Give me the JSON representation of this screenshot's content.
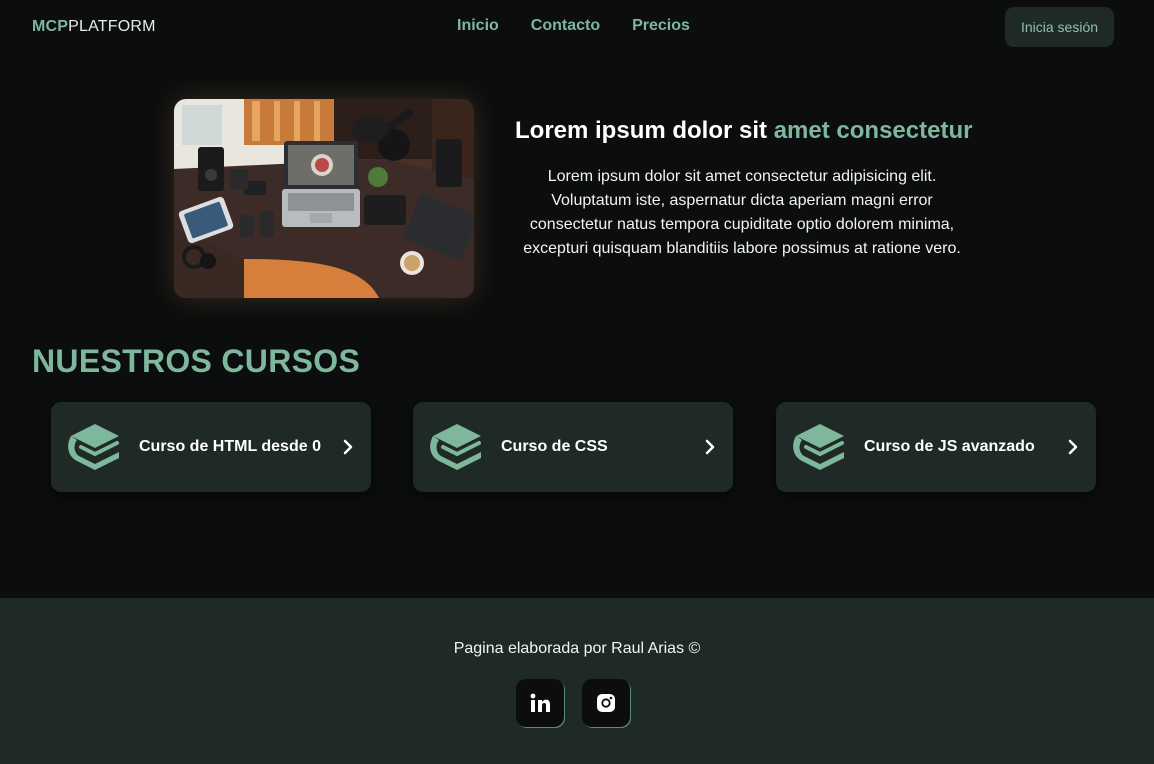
{
  "header": {
    "logo_accent": "MCP",
    "logo_rest": "PLATFORM",
    "nav": [
      "Inicio",
      "Contacto",
      "Precios"
    ],
    "login_label": "Inicia sesión"
  },
  "hero": {
    "title_main": "Lorem ipsum dolor sit ",
    "title_highlight": "amet consectetur",
    "text": "Lorem ipsum dolor sit amet consectetur adipisicing elit. Voluptatum iste, aspernatur dicta aperiam magni error consectetur natus tempora cupiditate optio dolorem minima, excepturi quisquam blanditiis labore possimus at ratione vero."
  },
  "courses": {
    "title": "NUESTROS CURSOS",
    "items": [
      {
        "label": "Curso de HTML desde 0"
      },
      {
        "label": "Curso de CSS"
      },
      {
        "label": "Curso de JS avanzado"
      }
    ]
  },
  "footer": {
    "text": "Pagina elaborada por Raul Arias ©",
    "social": [
      "linkedin-icon",
      "instagram-icon"
    ]
  },
  "colors": {
    "background": "#0b0d0e",
    "accent": "#7eb79b",
    "card": "#1f2a27"
  }
}
